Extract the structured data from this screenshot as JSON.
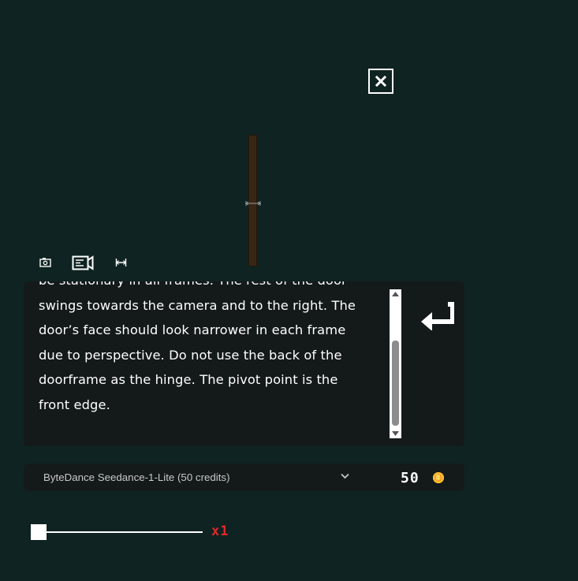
{
  "close_button": {
    "icon": "close-icon"
  },
  "toolbar": {
    "items": [
      {
        "icon": "camera-icon"
      },
      {
        "icon": "video-camera-icon"
      },
      {
        "icon": "resize-icon"
      }
    ]
  },
  "prompt": {
    "lines": [
      "be stationary in all frames. The rest of the door",
      "swings towards the camera and to the right. The",
      "door’s face should look narrower in each frame",
      "due to perspective. Do not use the back of the",
      "doorframe as the hinge. The pivot point is the",
      "front edge."
    ],
    "submit_icon": "enter-arrow-icon"
  },
  "model_selector": {
    "selected": "ByteDance Seedance-1-Lite (50 credits)",
    "credits": "50",
    "credit_icon": "coin-icon"
  },
  "speed_slider": {
    "label": "x1",
    "value": 0
  },
  "colors": {
    "background": "#0f2322",
    "panel": "#141a1a",
    "accent_red": "#e02a2a",
    "door": "#3a2615"
  }
}
